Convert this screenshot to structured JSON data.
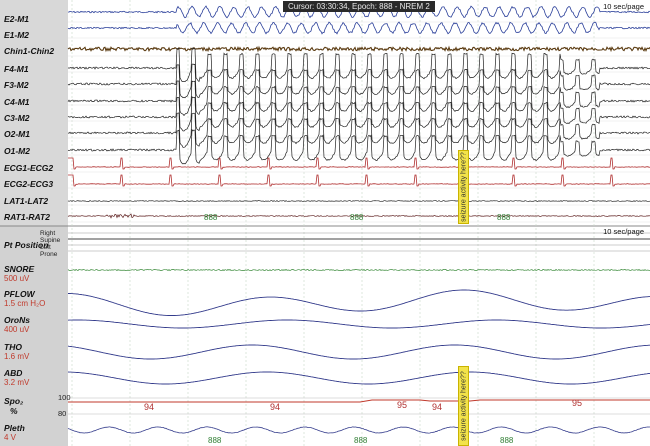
{
  "header": {
    "cursor": "Cursor: 03:30:34, Epoch: 888 - NREM 2"
  },
  "page_rate": "10 sec/page",
  "eeg_channels": [
    "E2-M1",
    "E1-M2",
    "Chin1-Chin2",
    "F4-M1",
    "F3-M2",
    "C4-M1",
    "C3-M2",
    "O2-M1",
    "O1-M2",
    "ECG1-ECG2",
    "ECG2-ECG3",
    "LAT1-LAT2",
    "RAT1-RAT2"
  ],
  "position": {
    "label": "Pt Position",
    "options": [
      "Right",
      "Supine",
      "Left",
      "Prone"
    ]
  },
  "resp_channels": [
    {
      "name": "SNORE",
      "scale": "500 uV"
    },
    {
      "name": "PFLOW",
      "scale": "1.5 cm H₂O"
    },
    {
      "name": "OroNs",
      "scale": "400 uV"
    },
    {
      "name": "THO",
      "scale": "1.6 mV"
    },
    {
      "name": "ABD",
      "scale": "3.2 mV"
    }
  ],
  "spo2": {
    "name": "Spo₂",
    "unit": "%",
    "top": "100",
    "bottom": "80",
    "values": [
      "94",
      "94",
      "95",
      "94",
      "95"
    ]
  },
  "pleth": {
    "name": "Pleth",
    "scale": "4 V"
  },
  "epoch_label": "888",
  "annotation": "seizure activity here??",
  "colors": {
    "eog": "#2a3f9a",
    "eeg": "#202020",
    "chin": "#5a3a10",
    "ecg": "#b03030",
    "resp": "#343c8c",
    "snore": "#3a8a3a",
    "spo2": "#c0392b",
    "marker": "#f2e34a"
  }
}
